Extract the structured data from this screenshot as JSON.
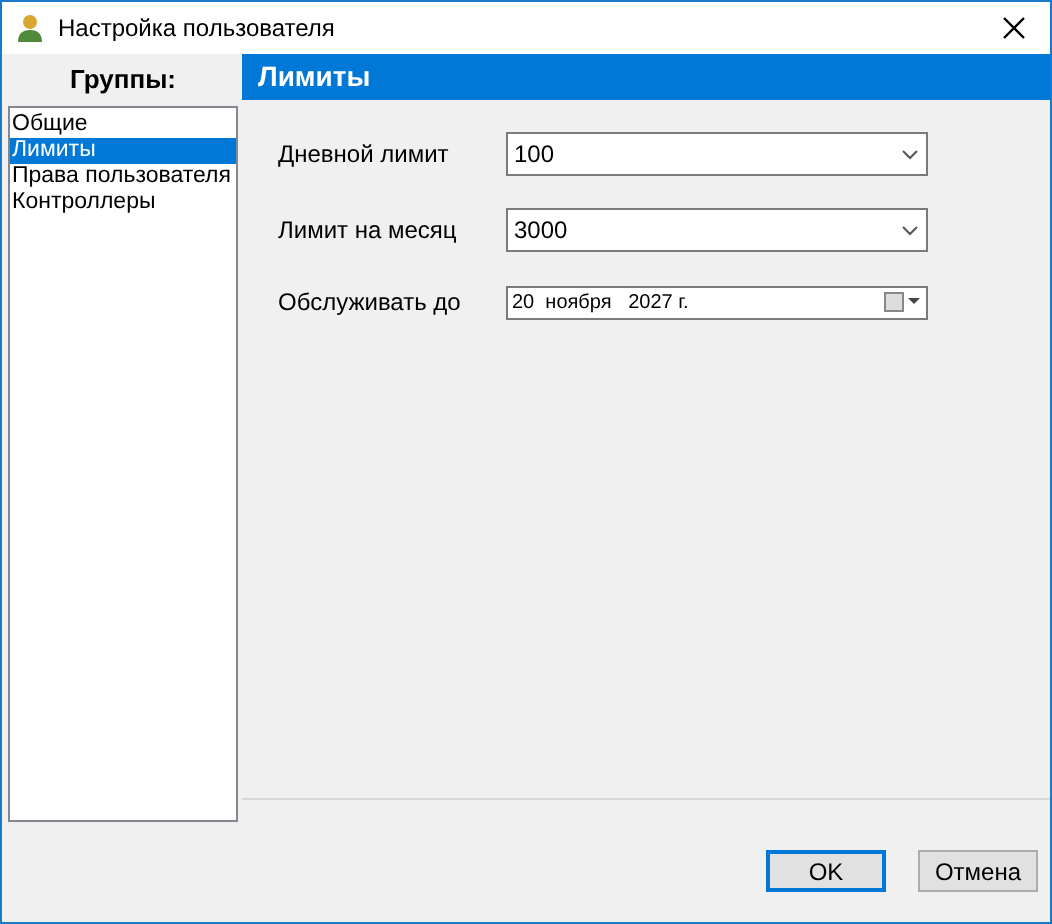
{
  "window": {
    "title": "Настройка пользователя"
  },
  "groups": {
    "header": "Группы:",
    "items": [
      {
        "label": "Общие",
        "selected": false
      },
      {
        "label": "Лимиты",
        "selected": true
      },
      {
        "label": "Права пользователя",
        "selected": false
      },
      {
        "label": "Контроллеры",
        "selected": false
      }
    ]
  },
  "panel": {
    "title": "Лимиты"
  },
  "fields": [
    {
      "kind": "combo",
      "label": "Дневной лимит",
      "value": "100"
    },
    {
      "kind": "combo",
      "label": "Лимит на месяц",
      "value": "3000"
    },
    {
      "kind": "date",
      "label": "Обслуживать до",
      "value": "20  ноября   2027 г."
    }
  ],
  "buttons": [
    {
      "label": "OK",
      "default": true
    },
    {
      "label": "Отмена",
      "default": false
    }
  ]
}
